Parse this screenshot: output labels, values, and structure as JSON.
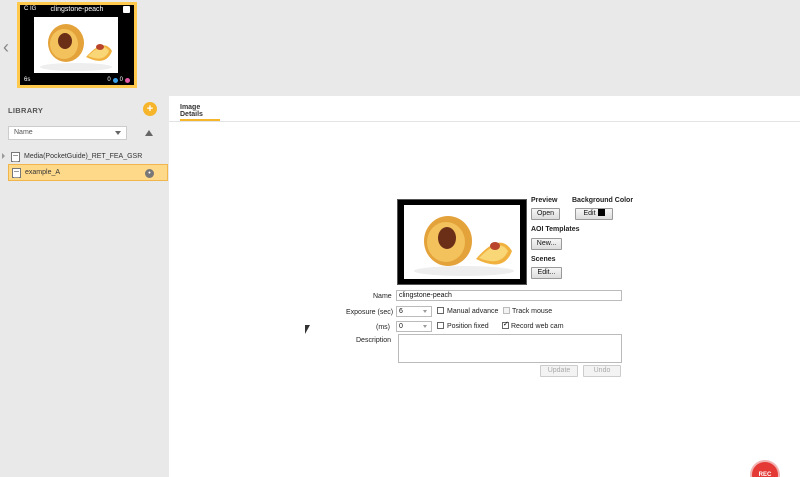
{
  "timeline": {
    "thumbnail": {
      "title": "clingstone-peach",
      "top_left": "C IG",
      "bottom_left": "6s",
      "bottom_right": "0",
      "bottom_right2": "0"
    }
  },
  "library": {
    "heading": "LIBRARY",
    "add_label": "+",
    "sort_value": "Name",
    "items": [
      {
        "label": "Media(PocketGuide)_RET_FEA_GSR"
      },
      {
        "label": "example_A"
      }
    ],
    "more_label": "•"
  },
  "main": {
    "tab_label": "Image Details",
    "preview": {
      "preview_label": "Preview",
      "open_label": "Open",
      "bgcolor_label": "Background Color",
      "edit_label": "Edit",
      "aoi_label": "AOI Templates",
      "new_label": "New...",
      "scenes_label": "Scenes",
      "scenes_edit_label": "Edit..."
    },
    "form": {
      "name_label": "Name",
      "name_value": "clingstone-peach",
      "exposure_label": "Exposure (sec)",
      "exposure_value": "6",
      "ms_label": "(ms)",
      "ms_value": "0",
      "manual_advance": "Manual advance",
      "track_mouse": "Track mouse",
      "position_fixed": "Position fixed",
      "record_web_cam": "Record web cam",
      "description_label": "Description",
      "description_value": "",
      "update_label": "Update",
      "undo_label": "Undo"
    }
  },
  "rec": {
    "label": "REC"
  },
  "colors": {
    "accent": "#f7b52b",
    "selected": "#ffd98a",
    "rec": "#e53935"
  }
}
